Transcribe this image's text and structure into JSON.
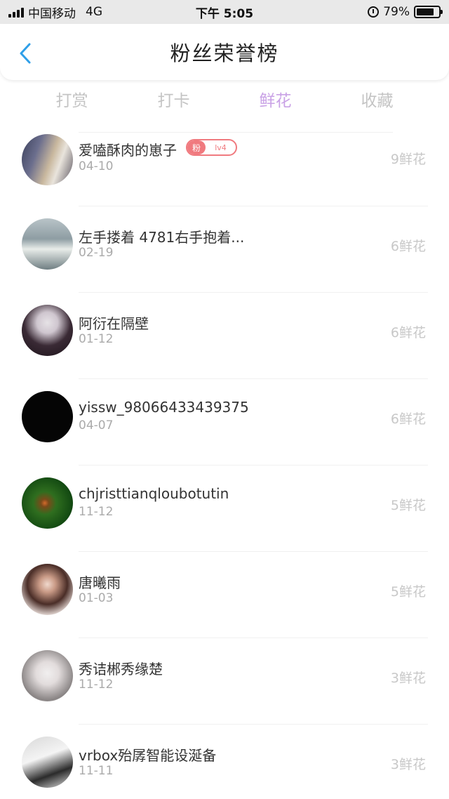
{
  "status_bar": {
    "carrier": "中国移动",
    "network": "4G",
    "time": "下午 5:05",
    "battery_percent": "79%",
    "battery_level": 0.79,
    "icons": [
      "signal-icon",
      "alarm-icon",
      "battery-icon"
    ]
  },
  "header": {
    "title": "粉丝荣誉榜",
    "back_icon": "chevron-left-icon",
    "accent_color": "#2f9fe8"
  },
  "tabs": [
    {
      "label": "打赏",
      "active": false
    },
    {
      "label": "打卡",
      "active": false
    },
    {
      "label": "鲜花",
      "active": true
    },
    {
      "label": "收藏",
      "active": false
    }
  ],
  "active_tab_color": "#c9a2e6",
  "fans": [
    {
      "name": "爱嗑酥肉的崽子",
      "date": "04-10",
      "count": "9鲜花",
      "badge": {
        "fan": "粉",
        "level": "lv4"
      }
    },
    {
      "name": "左手搂着 4781右手抱着...",
      "date": "02-19",
      "count": "6鲜花"
    },
    {
      "name": "阿衍在隔壁",
      "date": "01-12",
      "count": "6鲜花"
    },
    {
      "name": "yissw_98066433439375",
      "date": "04-07",
      "count": "6鲜花"
    },
    {
      "name": "chjristtianqloubotutin",
      "date": "11-12",
      "count": "5鲜花"
    },
    {
      "name": "唐曦雨",
      "date": "01-03",
      "count": "5鲜花"
    },
    {
      "name": "秀诘郴秀缘楚",
      "date": "11-12",
      "count": "3鲜花"
    },
    {
      "name": "vrbox殆孱智能设涎备",
      "date": "11-11",
      "count": "3鲜花"
    }
  ]
}
